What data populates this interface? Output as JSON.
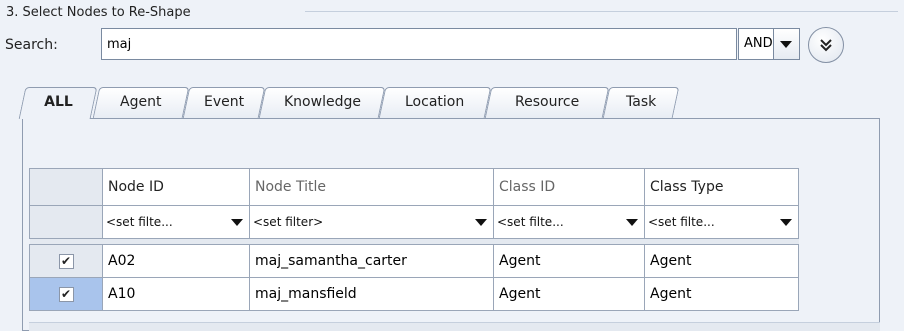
{
  "section": {
    "title": "3. Select Nodes to Re-Shape"
  },
  "search": {
    "label": "Search:",
    "value": "maj",
    "operator": "AND"
  },
  "tabs": [
    {
      "label": "ALL",
      "active": true
    },
    {
      "label": "Agent"
    },
    {
      "label": "Event"
    },
    {
      "label": "Knowledge"
    },
    {
      "label": "Location"
    },
    {
      "label": "Resource"
    },
    {
      "label": "Task"
    }
  ],
  "table": {
    "columns": [
      "Node ID",
      "Node Title",
      "Class ID",
      "Class Type"
    ],
    "filters": [
      "<set filte...",
      "<set filter>",
      "<set filte...",
      "<set filte..."
    ],
    "rows": [
      {
        "checked": true,
        "selected": false,
        "cells": [
          "A02",
          "maj_samantha_carter",
          "Agent",
          "Agent"
        ]
      },
      {
        "checked": true,
        "selected": true,
        "cells": [
          "A10",
          "maj_mansfield",
          "Agent",
          "Agent"
        ]
      }
    ]
  },
  "icons": {
    "expand": "double-chevron-down-icon",
    "dropdown": "triangle-down-icon",
    "check": "checkmark-icon"
  }
}
